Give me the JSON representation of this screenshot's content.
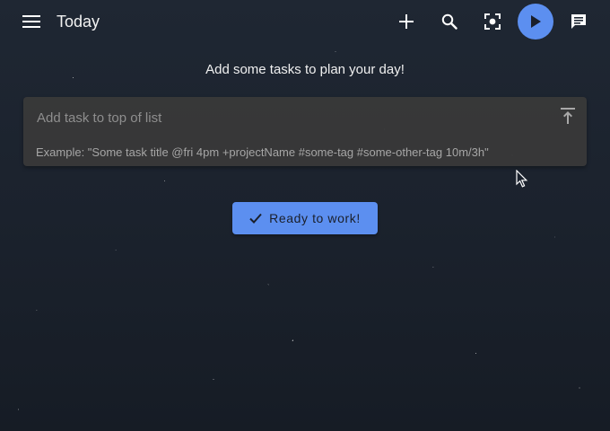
{
  "header": {
    "title": "Today",
    "icons": {
      "menu": "menu-icon",
      "add": "plus-icon",
      "search": "search-icon",
      "focus": "focus-mode-icon",
      "play": "play-icon",
      "notes": "comment-icon"
    },
    "accent_color": "#5c8ff0"
  },
  "main": {
    "empty_message": "Add some tasks to plan your day!",
    "add_task": {
      "placeholder": "Add task to top of list",
      "value": "",
      "hint": "Example: \"Some task title @fri 4pm +projectName #some-tag #some-other-tag 10m/3h\"",
      "action_icon": "add-to-top-icon"
    },
    "ready_button": {
      "label": "Ready to work!",
      "icon": "check-icon"
    }
  }
}
